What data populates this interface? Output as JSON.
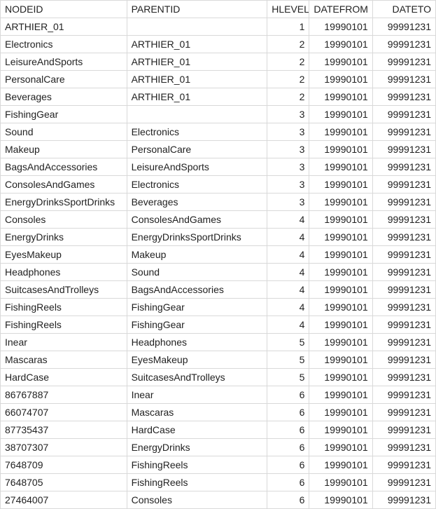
{
  "table": {
    "headers": {
      "nodeid": "NODEID",
      "parentid": "PARENTID",
      "hlevel": "HLEVEL",
      "datefrom": "DATEFROM",
      "dateto": "DATETO"
    },
    "rows": [
      {
        "nodeid": "ARTHIER_01",
        "parentid": "",
        "hlevel": 1,
        "datefrom": "19990101",
        "dateto": "99991231"
      },
      {
        "nodeid": "Electronics",
        "parentid": "ARTHIER_01",
        "hlevel": 2,
        "datefrom": "19990101",
        "dateto": "99991231"
      },
      {
        "nodeid": "LeisureAndSports",
        "parentid": "ARTHIER_01",
        "hlevel": 2,
        "datefrom": "19990101",
        "dateto": "99991231"
      },
      {
        "nodeid": "PersonalCare",
        "parentid": "ARTHIER_01",
        "hlevel": 2,
        "datefrom": "19990101",
        "dateto": "99991231"
      },
      {
        "nodeid": "Beverages",
        "parentid": "ARTHIER_01",
        "hlevel": 2,
        "datefrom": "19990101",
        "dateto": "99991231"
      },
      {
        "nodeid": "FishingGear",
        "parentid": "",
        "hlevel": 3,
        "datefrom": "19990101",
        "dateto": "99991231"
      },
      {
        "nodeid": "Sound",
        "parentid": "Electronics",
        "hlevel": 3,
        "datefrom": "19990101",
        "dateto": "99991231"
      },
      {
        "nodeid": "Makeup",
        "parentid": "PersonalCare",
        "hlevel": 3,
        "datefrom": "19990101",
        "dateto": "99991231"
      },
      {
        "nodeid": "BagsAndAccessories",
        "parentid": "LeisureAndSports",
        "hlevel": 3,
        "datefrom": "19990101",
        "dateto": "99991231"
      },
      {
        "nodeid": "ConsolesAndGames",
        "parentid": "Electronics",
        "hlevel": 3,
        "datefrom": "19990101",
        "dateto": "99991231"
      },
      {
        "nodeid": "EnergyDrinksSportDrinks",
        "parentid": "Beverages",
        "hlevel": 3,
        "datefrom": "19990101",
        "dateto": "99991231"
      },
      {
        "nodeid": "Consoles",
        "parentid": "ConsolesAndGames",
        "hlevel": 4,
        "datefrom": "19990101",
        "dateto": "99991231"
      },
      {
        "nodeid": "EnergyDrinks",
        "parentid": "EnergyDrinksSportDrinks",
        "hlevel": 4,
        "datefrom": "19990101",
        "dateto": "99991231"
      },
      {
        "nodeid": "EyesMakeup",
        "parentid": "Makeup",
        "hlevel": 4,
        "datefrom": "19990101",
        "dateto": "99991231"
      },
      {
        "nodeid": "Headphones",
        "parentid": "Sound",
        "hlevel": 4,
        "datefrom": "19990101",
        "dateto": "99991231"
      },
      {
        "nodeid": "SuitcasesAndTrolleys",
        "parentid": "BagsAndAccessories",
        "hlevel": 4,
        "datefrom": "19990101",
        "dateto": "99991231"
      },
      {
        "nodeid": "FishingReels",
        "parentid": "FishingGear",
        "hlevel": 4,
        "datefrom": "19990101",
        "dateto": "99991231"
      },
      {
        "nodeid": "FishingReels",
        "parentid": "FishingGear",
        "hlevel": 4,
        "datefrom": "19990101",
        "dateto": "99991231"
      },
      {
        "nodeid": "Inear",
        "parentid": "Headphones",
        "hlevel": 5,
        "datefrom": "19990101",
        "dateto": "99991231"
      },
      {
        "nodeid": "Mascaras",
        "parentid": "EyesMakeup",
        "hlevel": 5,
        "datefrom": "19990101",
        "dateto": "99991231"
      },
      {
        "nodeid": "HardCase",
        "parentid": "SuitcasesAndTrolleys",
        "hlevel": 5,
        "datefrom": "19990101",
        "dateto": "99991231"
      },
      {
        "nodeid": "86767887",
        "parentid": "Inear",
        "hlevel": 6,
        "datefrom": "19990101",
        "dateto": "99991231"
      },
      {
        "nodeid": "66074707",
        "parentid": "Mascaras",
        "hlevel": 6,
        "datefrom": "19990101",
        "dateto": "99991231"
      },
      {
        "nodeid": "87735437",
        "parentid": "HardCase",
        "hlevel": 6,
        "datefrom": "19990101",
        "dateto": "99991231"
      },
      {
        "nodeid": "38707307",
        "parentid": "EnergyDrinks",
        "hlevel": 6,
        "datefrom": "19990101",
        "dateto": "99991231"
      },
      {
        "nodeid": "7648709",
        "parentid": "FishingReels",
        "hlevel": 6,
        "datefrom": "19990101",
        "dateto": "99991231"
      },
      {
        "nodeid": "7648705",
        "parentid": "FishingReels",
        "hlevel": 6,
        "datefrom": "19990101",
        "dateto": "99991231"
      },
      {
        "nodeid": "27464007",
        "parentid": "Consoles",
        "hlevel": 6,
        "datefrom": "19990101",
        "dateto": "99991231"
      }
    ]
  }
}
